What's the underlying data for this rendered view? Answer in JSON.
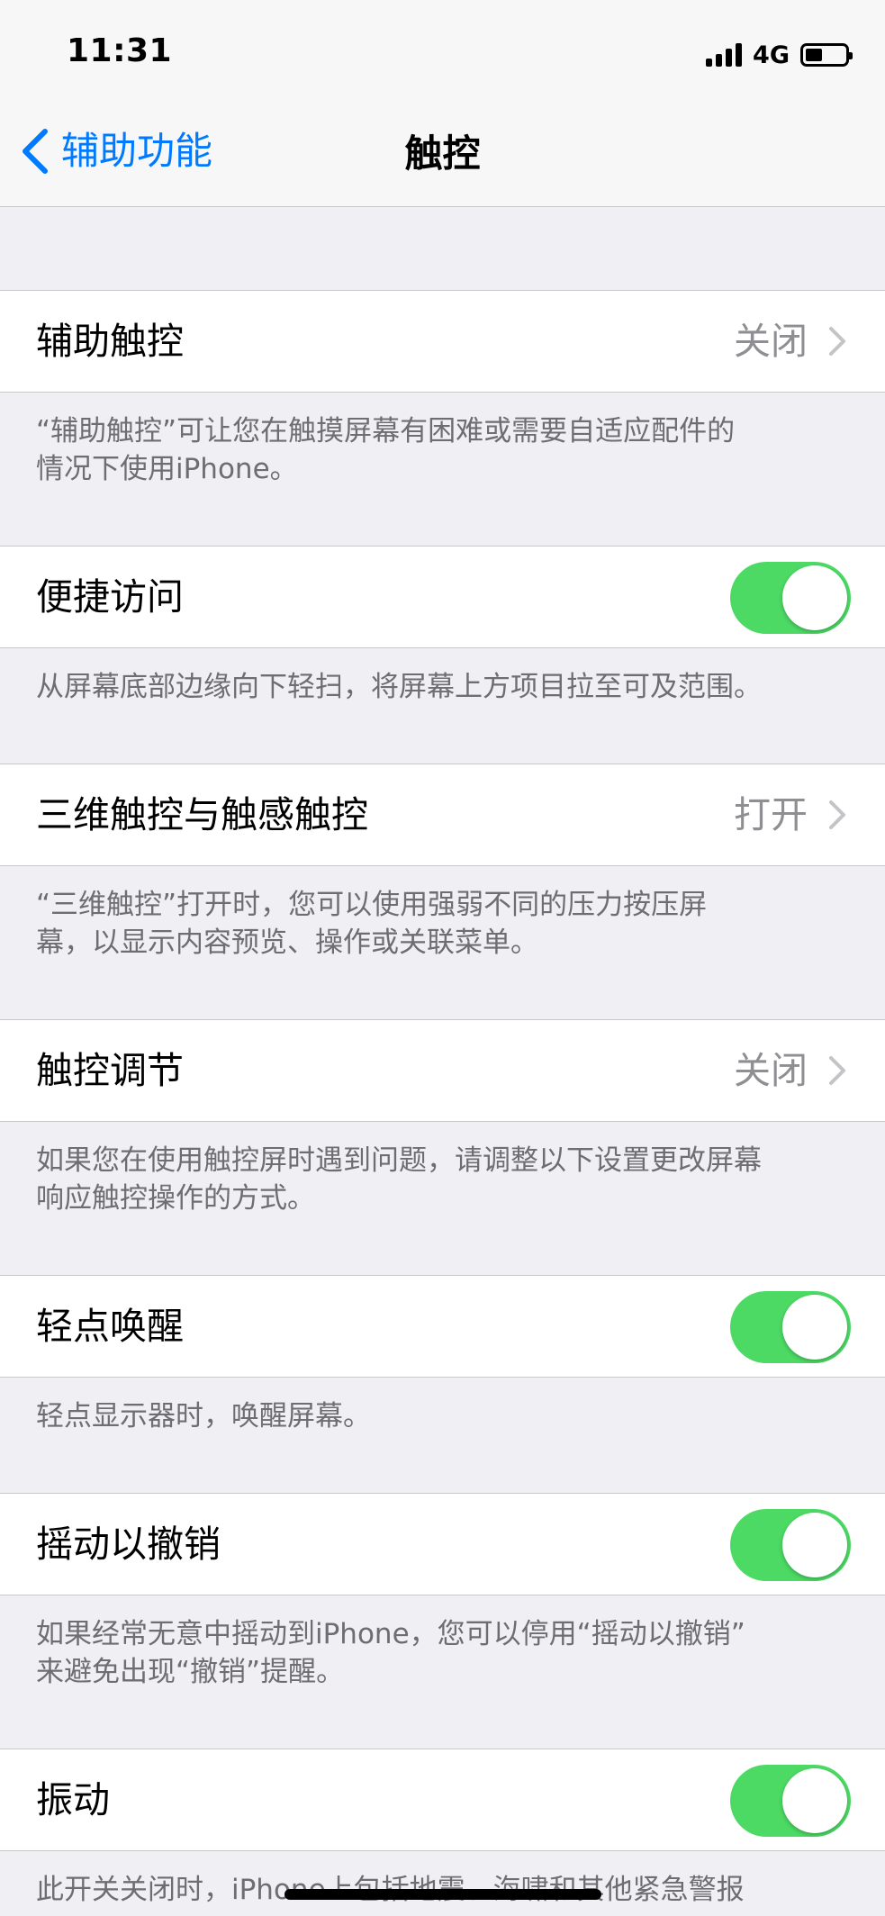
{
  "status_bar": {
    "time": "11:31",
    "network": "4G",
    "signal_icon": "signal-bars-icon",
    "battery_icon": "battery-icon"
  },
  "nav": {
    "back_label": "辅助功能",
    "back_icon": "chevron-left-icon",
    "title": "触控"
  },
  "sections": [
    {
      "label": "辅助触控",
      "value": "关闭",
      "note": "“辅助触控”可让您在触摸屏幕有困难或需要自适应配件的\n情况下使用iPhone。"
    },
    {
      "label": "便捷访问",
      "toggle_on": true,
      "note": "从屏幕底部边缘向下轻扫，将屏幕上方项目拉至可及范围。"
    },
    {
      "label": "三维触控与触感触控",
      "value": "打开",
      "note": "“三维触控”打开时，您可以使用强弱不同的压力按压屏\n幕，以显示内容预览、操作或关联菜单。"
    },
    {
      "label": "触控调节",
      "value": "关闭",
      "note": "如果您在使用触控屏时遇到问题，请调整以下设置更改屏幕\n响应触控操作的方式。"
    },
    {
      "label": "轻点唤醒",
      "toggle_on": true,
      "note": "轻点显示器时，唤醒屏幕。"
    },
    {
      "label": "摇动以撤销",
      "toggle_on": true,
      "note": "如果经常无意中摇动到iPhone，您可以停用“摇动以撤销”\n来避免出现“撤销”提醒。"
    },
    {
      "label": "振动",
      "toggle_on": true,
      "note": "此开关关闭时，iPhone上包括地震、海啸和其他紧急警报"
    }
  ],
  "colors": {
    "accent": "#007aff",
    "toggle_on": "#4cd964",
    "background": "#efeff4",
    "secondary_text": "#8e8e93",
    "footnote_text": "#6d6d72"
  }
}
